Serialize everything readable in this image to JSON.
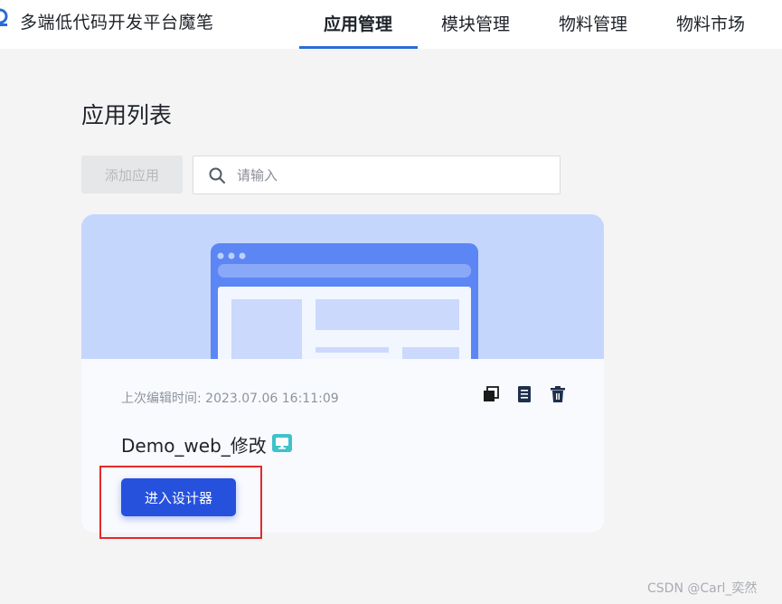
{
  "header": {
    "brand": "多端低代码开发平台魔笔",
    "nav": [
      {
        "label": "应用管理",
        "active": true
      },
      {
        "label": "模块管理",
        "active": false
      },
      {
        "label": "物料管理",
        "active": false
      },
      {
        "label": "物料市场",
        "active": false
      }
    ]
  },
  "main": {
    "title": "应用列表",
    "add_button": "添加应用",
    "search": {
      "placeholder": "请输入",
      "value": ""
    }
  },
  "card": {
    "edit_time": "上次编辑时间: 2023.07.06 16:11:09",
    "actions": [
      "copy-icon",
      "document-icon",
      "trash-icon"
    ],
    "app_name": "Demo_web_修改",
    "platform_icon": "monitor-icon",
    "enter_button": "进入设计器"
  },
  "watermark": "CSDN @Carl_奕然",
  "colors": {
    "accent": "#2a6bd9",
    "primary_button": "#2651dc",
    "card_banner": "#c5d6fd",
    "badge": "#3fc2c9",
    "highlight": "#e5292b"
  }
}
